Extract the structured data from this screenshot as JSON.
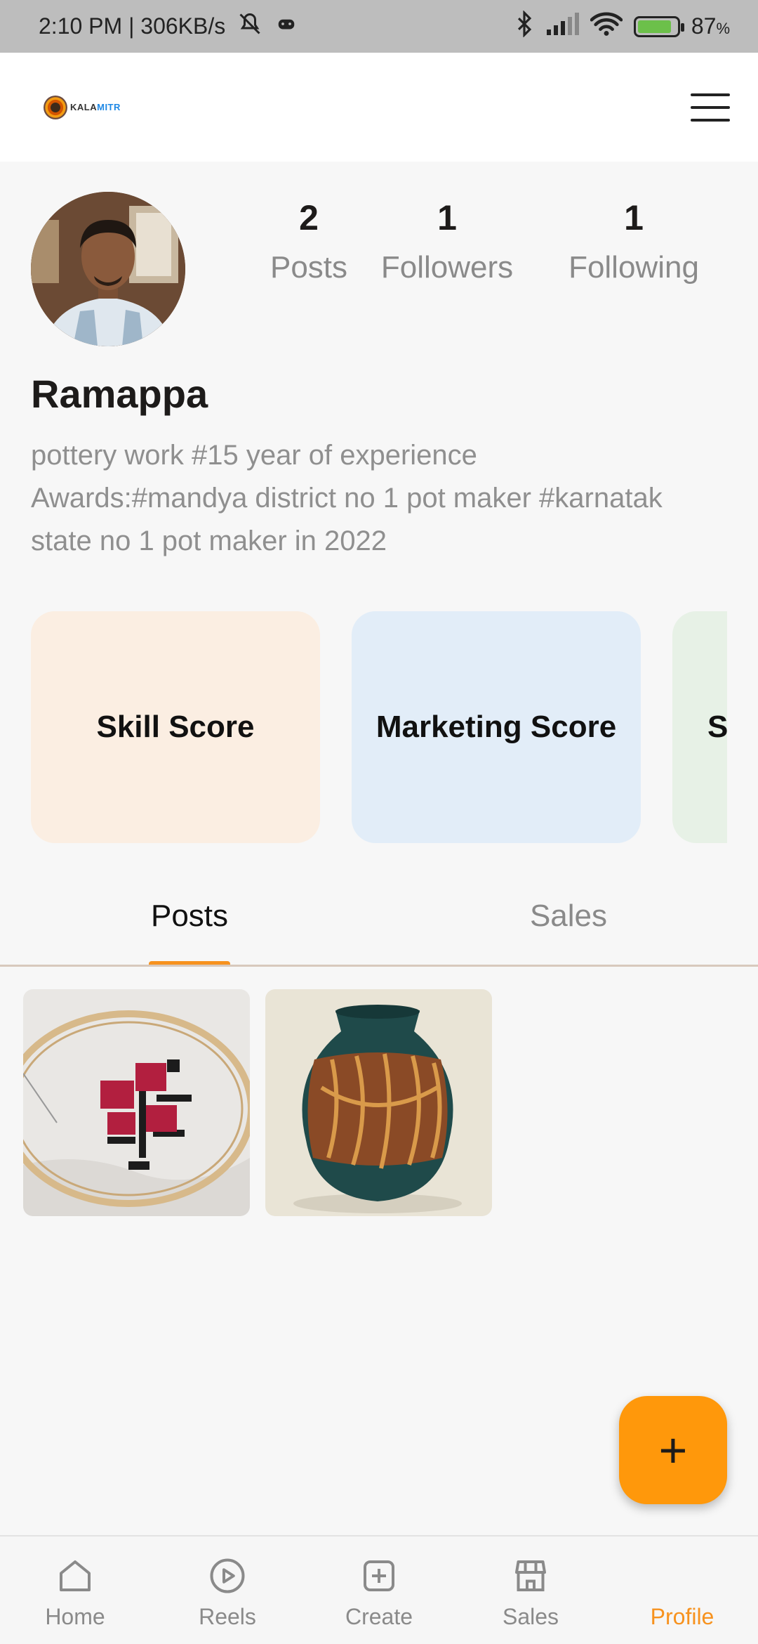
{
  "status_bar": {
    "time_speed": "2:10 PM | 306KB/s",
    "battery": "87",
    "battery_unit": "%"
  },
  "header": {
    "logo_text_a": "KALA",
    "logo_text_b": "MITR"
  },
  "profile": {
    "name": "Ramappa",
    "bio_lines": [
      "pottery work #15 year of experience",
      "Awards:#mandya district no 1 pot maker #karnatak",
      "state no 1 pot maker in 2022"
    ],
    "stats": [
      {
        "value": "2",
        "label": "Posts"
      },
      {
        "value": "1",
        "label": "Followers"
      },
      {
        "value": "1",
        "label": "Following"
      }
    ]
  },
  "score_cards": [
    {
      "label": "Skill Score"
    },
    {
      "label": "Marketing Score"
    },
    {
      "label": "Sa"
    }
  ],
  "tabs": [
    {
      "label": "Posts",
      "active": true
    },
    {
      "label": "Sales",
      "active": false
    }
  ],
  "posts": [
    {
      "subject": "embroidery-rose"
    },
    {
      "subject": "pottery-vase"
    }
  ],
  "fab": {
    "symbol": "+"
  },
  "bottom_nav": [
    {
      "label": "Home",
      "icon": "home-icon"
    },
    {
      "label": "Reels",
      "icon": "play-icon"
    },
    {
      "label": "Create",
      "icon": "add-box-icon"
    },
    {
      "label": "Sales",
      "icon": "store-icon"
    },
    {
      "label": "Profile",
      "icon": "",
      "active": true
    }
  ],
  "colors": {
    "accent": "#f7921e",
    "fab": "#ff980b",
    "skill_card": "#fbeee2",
    "marketing_card": "#e2edf8",
    "sales_card": "#e7f1e6"
  }
}
